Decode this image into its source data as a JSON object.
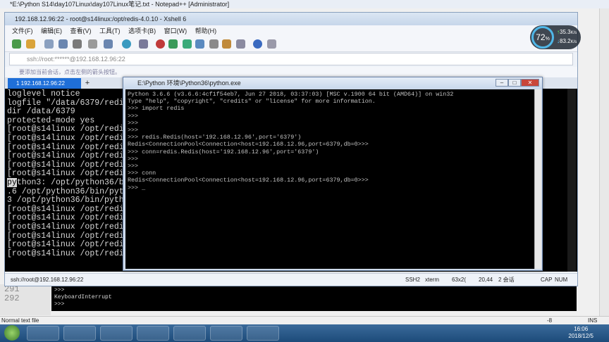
{
  "notepad": {
    "title": "*E:\\Python S14\\day107Linux\\day107Linux笔记.txt - Notepad++ [Administrator]",
    "status_left": "Normal text file",
    "status_right_col": "-8",
    "status_ins": "INS",
    "gutter_lines": [
      "291",
      "292"
    ],
    "console_lines": [
      ">>>",
      "KeyboardInterrupt",
      ">>>"
    ]
  },
  "xshell": {
    "title": "192.168.12.96:22 - root@s14linux:/opt/redis-4.0.10 - Xshell 6",
    "menu": [
      "文件(F)",
      "编辑(E)",
      "查看(V)",
      "工具(T)",
      "选项卡(B)",
      "窗口(W)",
      "帮助(H)"
    ],
    "address": "ssh://root:******@192.168.12.96:22",
    "notice": "要添加当前会话，点击左侧的箭头按钮。",
    "tab_label": "1 192.168.12.96:22",
    "terminal_lines": [
      "loglevel notice",
      "logfile \"/data/6379/redis.",
      "dir /data/6379",
      "protected-mode yes",
      "[root@s14linux /opt/redis-",
      "[root@s14linux /opt/redis-",
      "[root@s14linux /opt/redis-",
      "[root@s14linux /opt/redis-",
      "[root@s14linux /opt/redis-",
      "[root@s14linux /opt/redis-",
      "thon3: /opt/python36/bin",
      ".6 /opt/python36/bin/pytho",
      "3 /opt/python36/bin/python",
      "[root@s14linux /opt/redis-",
      "[root@s14linux /opt/redis-",
      "[root@s14linux /opt/redis-",
      "[root@s14linux /opt/redis-",
      "[root@s14linux /opt/redis-",
      "[root@s14linux /opt/redis-"
    ],
    "terminal_sel_prefix": "py",
    "status": {
      "session": "ssh://root@192.168.12.96:22",
      "protocol": "SSH2",
      "term": "xterm",
      "size": "63x2(",
      "pos": "20,44",
      "sessions": "2 会话",
      "cap": "CAP",
      "num": "NUM"
    }
  },
  "speed_widget": {
    "percent": "72",
    "percent_unit": "%",
    "up": "35.3",
    "up_unit": "K/s",
    "down": "83.2",
    "down_unit": "K/s"
  },
  "pywin": {
    "title": "E:\\Python 环境\\Python36\\python.exe",
    "lines": [
      "Python 3.6.6 (v3.6.6:4cf1f54eb7, Jun 27 2018, 03:37:03) [MSC v.1900 64 bit (AMD64)] on win32",
      "Type \"help\", \"copyright\", \"credits\" or \"license\" for more information.",
      ">>> import redis",
      ">>>",
      ">>>",
      ">>>",
      ">>> redis.Redis(host='192.168.12.96',port='6379')",
      "Redis<ConnectionPool<Connection<host=192.168.12.96,port=6379,db=0>>>",
      ">>> conn=redis.Redis(host='192.168.12.96',port='6379')",
      ">>>",
      ">>>",
      ">>> conn",
      "Redis<ConnectionPool<Connection<host=192.168.12.96,port=6379,db=0>>>",
      ">>> _"
    ]
  },
  "taskbar": {
    "time": "16:06",
    "date": "2018/12/5"
  }
}
